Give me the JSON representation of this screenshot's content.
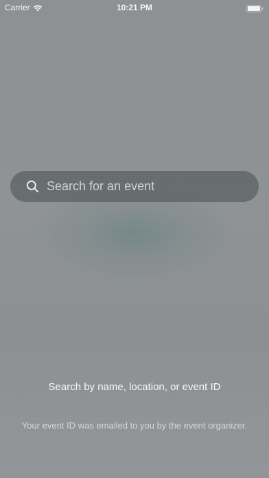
{
  "status_bar": {
    "carrier": "Carrier",
    "time": "10:21 PM"
  },
  "search": {
    "placeholder": "Search for an event",
    "value": ""
  },
  "help": {
    "title": "Search by name, location, or event ID",
    "subtitle": "Your event ID was emailed to you by the event organizer."
  },
  "icons": {
    "signal": "wifi-icon",
    "battery": "battery-icon",
    "search": "search-icon"
  },
  "colors": {
    "background": "#8e9294",
    "search_field": "#50565a"
  }
}
